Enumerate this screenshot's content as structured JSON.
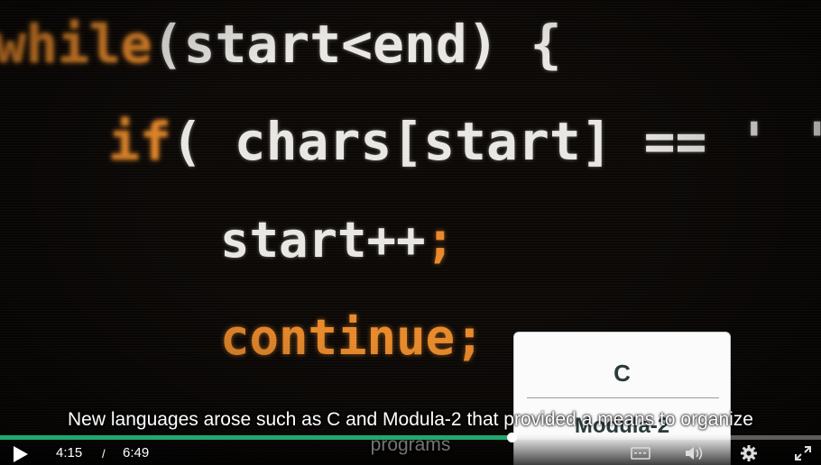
{
  "video": {
    "code_lines": {
      "line1_keyword": "while",
      "line1_rest": "(start<end) {",
      "line2_keyword": "if",
      "line2_rest": "( chars[start] == ' ') {",
      "line3": "start++",
      "line3_semicolon": ";",
      "line4": "continue;"
    }
  },
  "quiz": {
    "option_a": "C",
    "option_b": "Modula-2"
  },
  "captions": {
    "line1": "New languages arose such as C and Modula-2 that provided a means to organize",
    "line2": "programs"
  },
  "controls": {
    "current_time": "4:15",
    "separator": "/",
    "duration": "6:49",
    "progress_fraction": 0.623,
    "accent_color": "#1fa86f",
    "icons": [
      "play-icon",
      "captions-icon",
      "volume-icon",
      "settings-gear-icon",
      "fullscreen-icon"
    ]
  }
}
